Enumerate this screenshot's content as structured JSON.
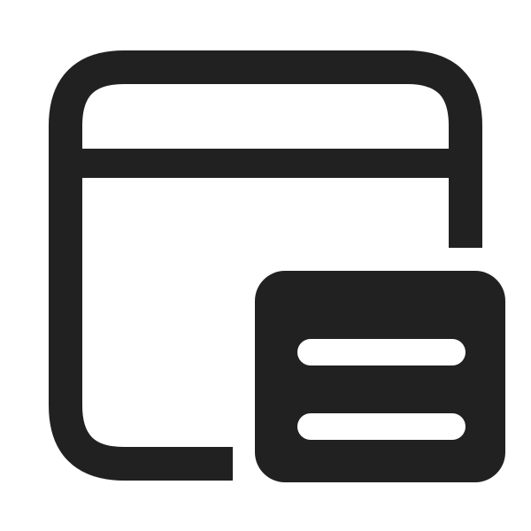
{
  "icon": {
    "name": "window-with-list-badge-icon",
    "color": "#212121",
    "background": "#ffffff",
    "parts": [
      "window-frame-icon",
      "title-bar-divider",
      "list-badge-icon",
      "list-line-top",
      "list-line-bottom"
    ]
  }
}
